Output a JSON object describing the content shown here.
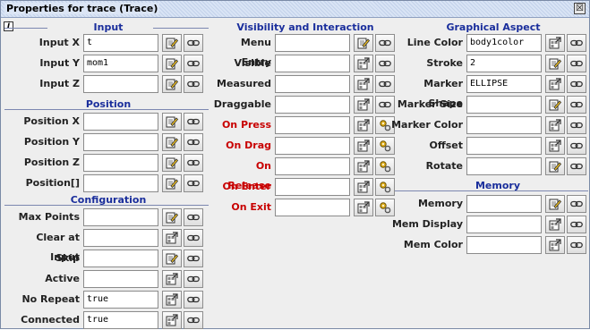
{
  "window": {
    "title": "Properties for trace (Trace)",
    "close_glyph": "☒",
    "info_glyph": "i"
  },
  "sections": {
    "input": "Input",
    "position": "Position",
    "configuration": "Configuration",
    "visibility": "Visibility and Interaction",
    "graphical": "Graphical Aspect",
    "memory": "Memory"
  },
  "input": [
    {
      "label": "Input X",
      "value": "t",
      "btn1": "edit-icon",
      "btn2": "link-icon"
    },
    {
      "label": "Input Y",
      "value": "mom1",
      "btn1": "edit-icon",
      "btn2": "link-icon"
    },
    {
      "label": "Input Z",
      "value": "",
      "btn1": "edit-icon",
      "btn2": "link-icon"
    }
  ],
  "position": [
    {
      "label": "Position X",
      "value": "",
      "btn1": "edit-icon",
      "btn2": "link-icon"
    },
    {
      "label": "Position Y",
      "value": "",
      "btn1": "edit-icon",
      "btn2": "link-icon"
    },
    {
      "label": "Position Z",
      "value": "",
      "btn1": "edit-icon",
      "btn2": "link-icon"
    },
    {
      "label": "Position[]",
      "value": "",
      "btn1": "edit-icon",
      "btn2": "link-icon"
    }
  ],
  "configuration": [
    {
      "label": "Max Points",
      "value": "",
      "btn1": "edit-icon",
      "btn2": "link-icon"
    },
    {
      "label": "Clear at Input",
      "value": "",
      "btn1": "select-icon",
      "btn2": "link-icon"
    },
    {
      "label": "Skip",
      "value": "",
      "btn1": "edit-icon",
      "btn2": "link-icon"
    },
    {
      "label": "Active",
      "value": "",
      "btn1": "select-icon",
      "btn2": "link-icon"
    },
    {
      "label": "No Repeat",
      "value": "true",
      "btn1": "select-icon",
      "btn2": "link-icon"
    },
    {
      "label": "Connected",
      "value": "true",
      "btn1": "select-icon",
      "btn2": "link-icon"
    }
  ],
  "visibility": [
    {
      "label": "Menu Entry",
      "value": "",
      "btn1": "edit-icon",
      "btn2": "link-icon",
      "red": false
    },
    {
      "label": "Visible",
      "value": "",
      "btn1": "select-icon",
      "btn2": "link-icon",
      "red": false
    },
    {
      "label": "Measured",
      "value": "",
      "btn1": "select-icon",
      "btn2": "link-icon",
      "red": false
    },
    {
      "label": "Draggable",
      "value": "",
      "btn1": "select-icon",
      "btn2": "link-icon",
      "red": false
    },
    {
      "label": "On Press",
      "value": "",
      "btn1": "select-icon",
      "btn2": "gears-icon",
      "red": true
    },
    {
      "label": "On Drag",
      "value": "",
      "btn1": "select-icon",
      "btn2": "gears-icon",
      "red": true
    },
    {
      "label": "On Release",
      "value": "",
      "btn1": "select-icon",
      "btn2": "gears-icon",
      "red": true
    },
    {
      "label": "On Enter",
      "value": "",
      "btn1": "select-icon",
      "btn2": "gears-icon",
      "red": true
    },
    {
      "label": "On Exit",
      "value": "",
      "btn1": "select-icon",
      "btn2": "gears-icon",
      "red": true
    }
  ],
  "graphical": [
    {
      "label": "Line Color",
      "value": "body1color",
      "btn1": "select-icon",
      "btn2": "link-icon"
    },
    {
      "label": "Stroke",
      "value": "2",
      "btn1": "edit-icon",
      "btn2": "link-icon"
    },
    {
      "label": "Marker Shape",
      "value": "ELLIPSE",
      "btn1": "select-icon",
      "btn2": "link-icon"
    },
    {
      "label": "Marker Size",
      "value": "",
      "btn1": "edit-icon",
      "btn2": "link-icon"
    },
    {
      "label": "Marker Color",
      "value": "",
      "btn1": "select-icon",
      "btn2": "link-icon"
    },
    {
      "label": "Offset",
      "value": "",
      "btn1": "select-icon",
      "btn2": "link-icon"
    },
    {
      "label": "Rotate",
      "value": "",
      "btn1": "edit-icon",
      "btn2": "link-icon"
    }
  ],
  "memory": [
    {
      "label": "Memory",
      "value": "",
      "btn1": "edit-icon",
      "btn2": "link-icon"
    },
    {
      "label": "Mem Display",
      "value": "",
      "btn1": "select-icon",
      "btn2": "link-icon"
    },
    {
      "label": "Mem Color",
      "value": "",
      "btn1": "select-icon",
      "btn2": "link-icon"
    }
  ]
}
